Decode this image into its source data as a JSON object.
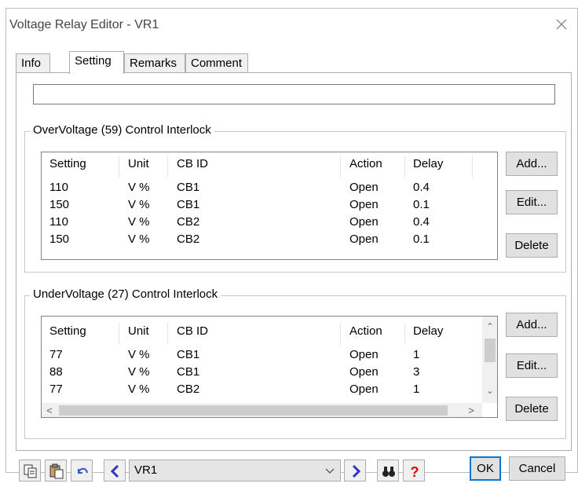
{
  "window": {
    "title": "Voltage Relay Editor - VR1"
  },
  "tabs": [
    {
      "label": "Info",
      "active": false
    },
    {
      "label": "Setting",
      "active": true
    },
    {
      "label": "Remarks",
      "active": false
    },
    {
      "label": "Comment",
      "active": false
    }
  ],
  "setting_input": {
    "value": ""
  },
  "overvoltage": {
    "title": "OverVoltage (59) Control Interlock",
    "columns": [
      "Setting",
      "Unit",
      "CB ID",
      "Action",
      "Delay"
    ],
    "rows": [
      [
        "110",
        "V %",
        "CB1",
        "Open",
        "0.4"
      ],
      [
        "150",
        "V %",
        "CB1",
        "Open",
        "0.1"
      ],
      [
        "110",
        "V %",
        "CB2",
        "Open",
        "0.4"
      ],
      [
        "150",
        "V %",
        "CB2",
        "Open",
        "0.1"
      ]
    ],
    "buttons": {
      "add": "Add...",
      "edit": "Edit...",
      "delete": "Delete"
    }
  },
  "undervoltage": {
    "title": "UnderVoltage (27) Control Interlock",
    "columns": [
      "Setting",
      "Unit",
      "CB ID",
      "Action",
      "Delay"
    ],
    "rows": [
      [
        "77",
        "V %",
        "CB1",
        "Open",
        "1"
      ],
      [
        "88",
        "V %",
        "CB1",
        "Open",
        "3"
      ],
      [
        "77",
        "V %",
        "CB2",
        "Open",
        "1"
      ]
    ],
    "buttons": {
      "add": "Add...",
      "edit": "Edit...",
      "delete": "Delete"
    }
  },
  "bottombar": {
    "selected_relay": "VR1",
    "ok_label": "OK",
    "cancel_label": "Cancel"
  },
  "colors": {
    "accent": "#0078d7",
    "nav_arrow": "#3333cc",
    "help": "#e00000"
  }
}
